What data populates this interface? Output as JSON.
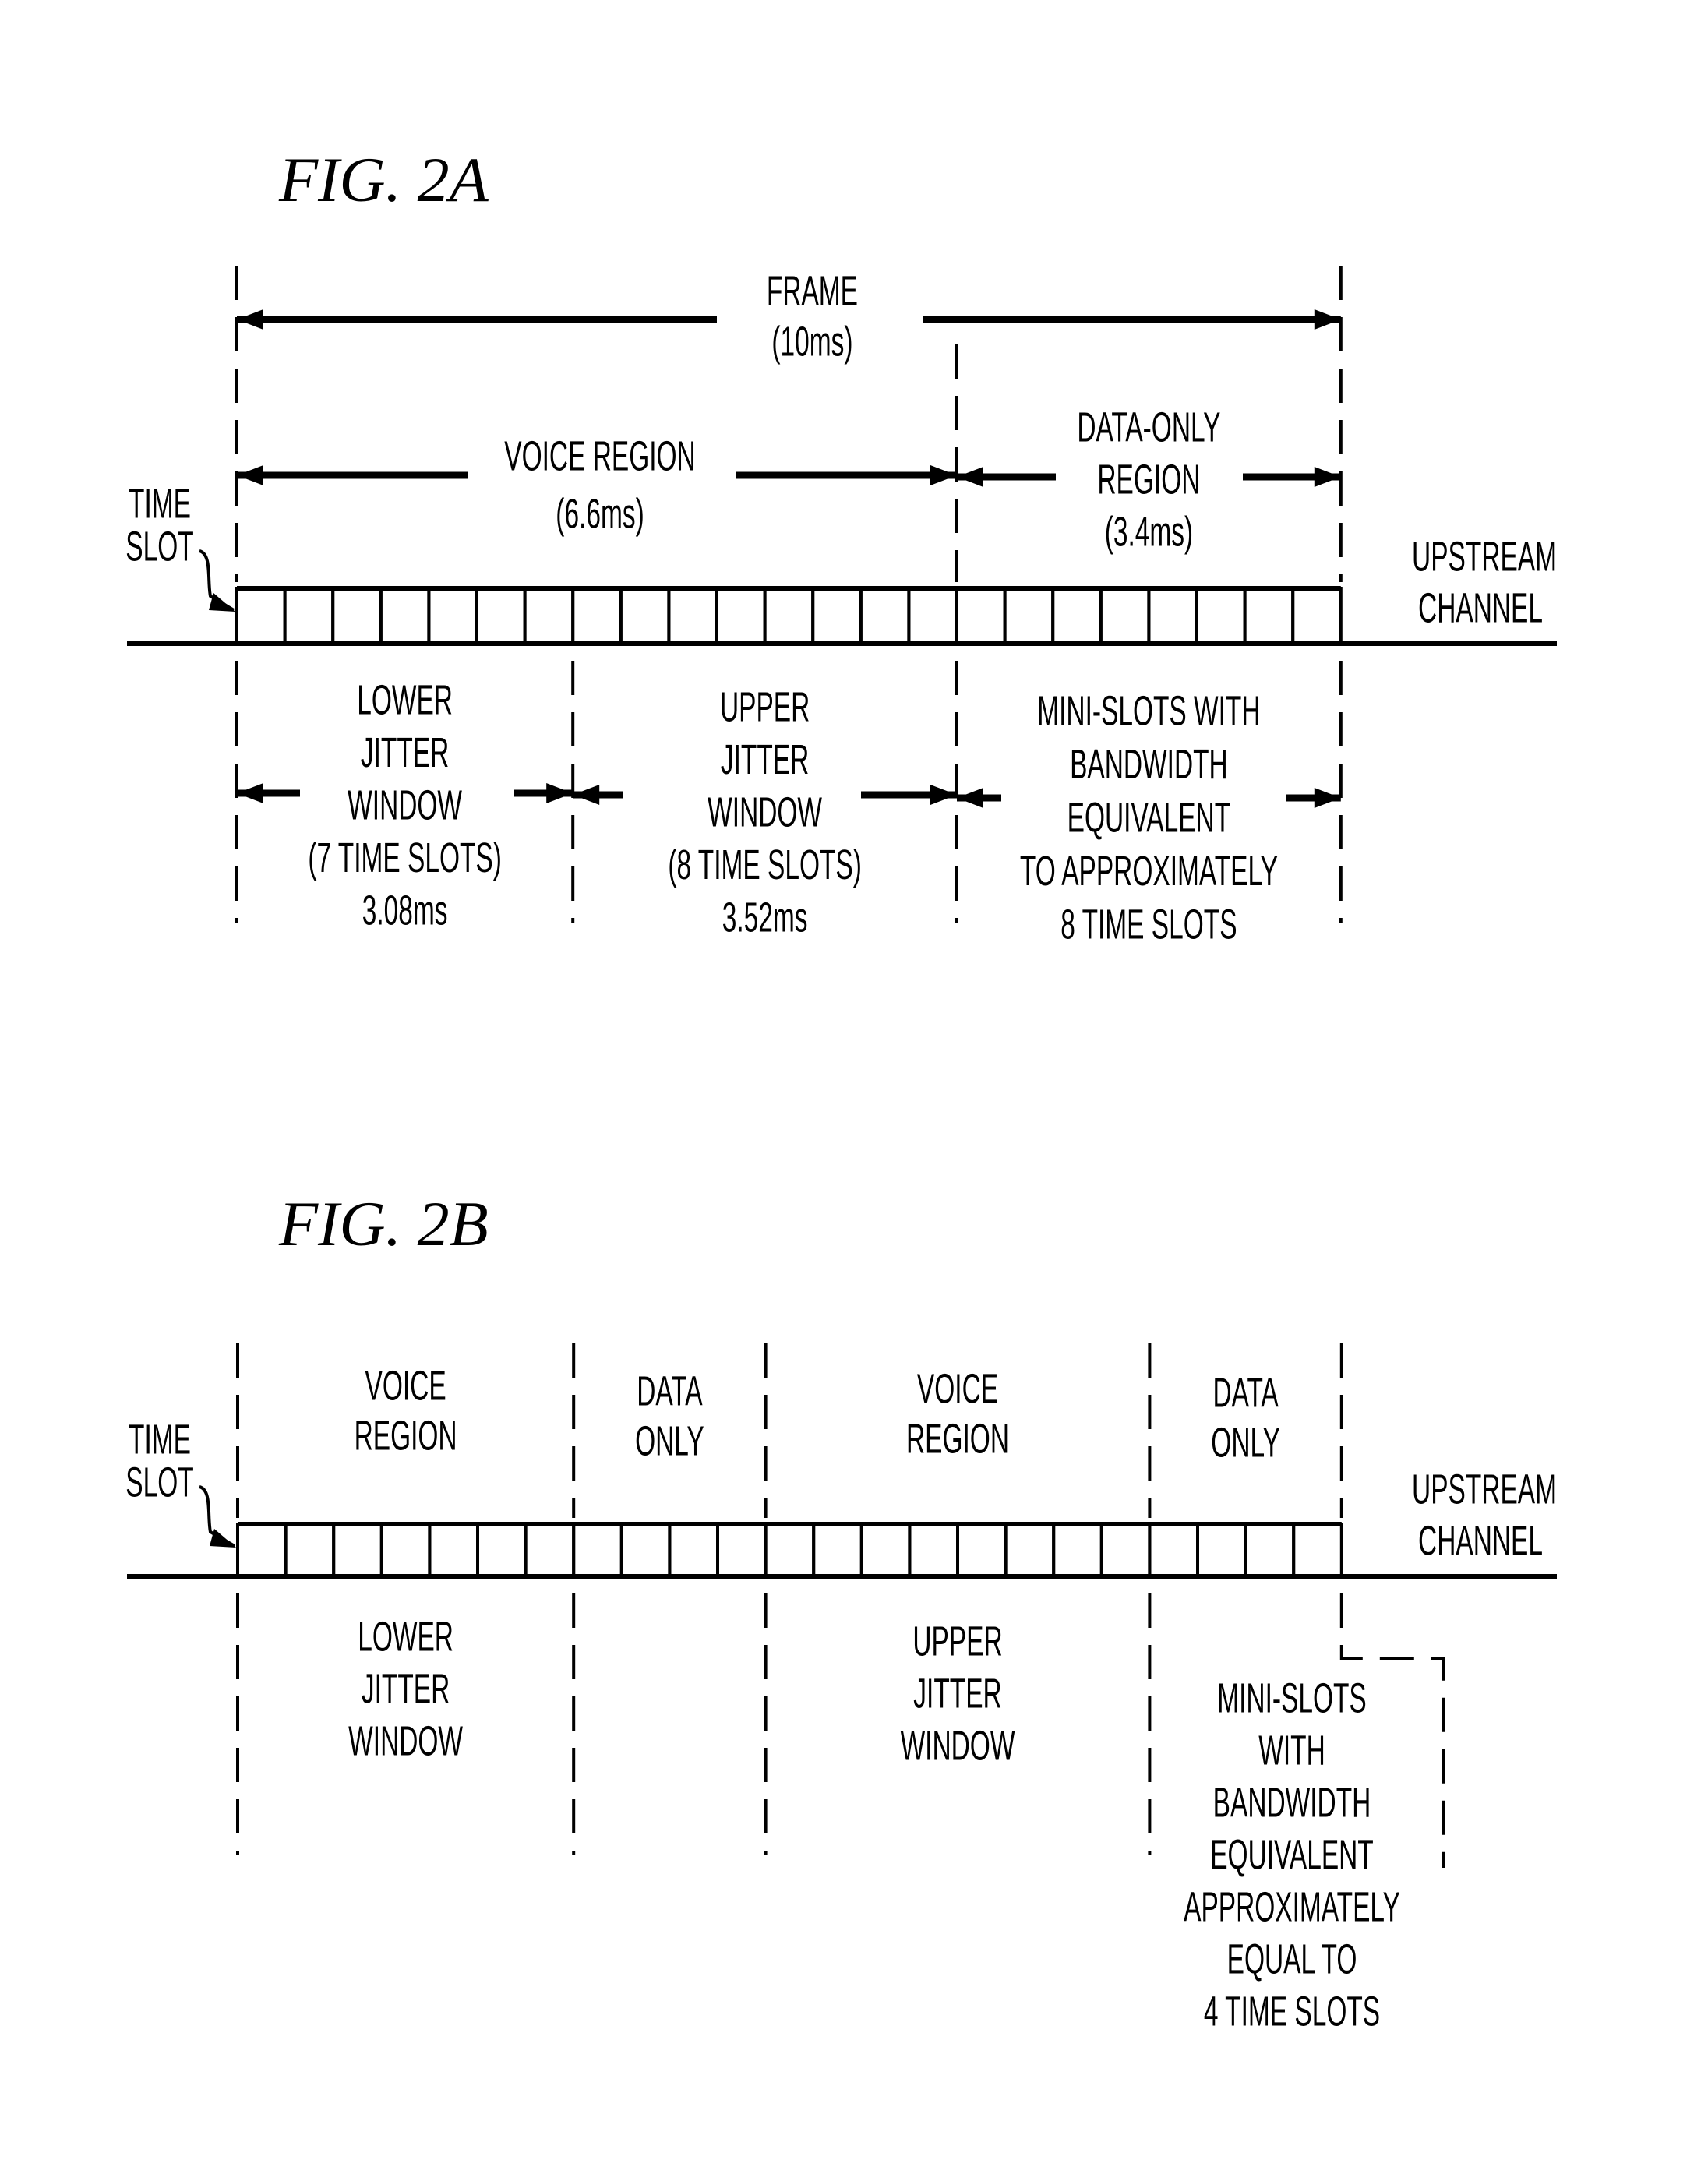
{
  "figures": [
    {
      "id": "fig2a",
      "title": "FIG. 2A",
      "time_slot_label": [
        "TIME",
        "SLOT"
      ],
      "channel_label": [
        "UPSTREAM",
        "CHANNEL"
      ],
      "total_time_slots": 23,
      "frame": {
        "label": "FRAME",
        "duration": "(10ms)"
      },
      "top_regions": [
        {
          "name": "voice-region",
          "lines": [
            "VOICE REGION",
            "(6.6ms)"
          ],
          "slots": 15
        },
        {
          "name": "data-only-region",
          "lines": [
            "DATA-ONLY",
            "REGION",
            "(3.4ms)"
          ],
          "slots": 8
        }
      ],
      "bottom_regions": [
        {
          "name": "lower-jitter-window",
          "lines": [
            "LOWER",
            "JITTER",
            "WINDOW",
            "(7 TIME SLOTS)",
            "3.08ms"
          ],
          "slots": 7
        },
        {
          "name": "upper-jitter-window",
          "lines": [
            "UPPER",
            "JITTER",
            "WINDOW",
            "(8 TIME SLOTS)",
            "3.52ms"
          ],
          "slots": 8
        },
        {
          "name": "mini-slots",
          "lines": [
            "MINI-SLOTS WITH",
            "BANDWIDTH",
            "EQUIVALENT",
            "TO APPROXIMATELY",
            "8 TIME SLOTS"
          ],
          "slots": 8
        }
      ]
    },
    {
      "id": "fig2b",
      "title": "FIG. 2B",
      "time_slot_label": [
        "TIME",
        "SLOT"
      ],
      "channel_label": [
        "UPSTREAM",
        "CHANNEL"
      ],
      "total_time_slots": 23,
      "top_regions": [
        {
          "name": "voice-region-1",
          "lines": [
            "VOICE",
            "REGION"
          ],
          "slots": 7
        },
        {
          "name": "data-only-1",
          "lines": [
            "DATA",
            "ONLY"
          ],
          "slots": 4
        },
        {
          "name": "voice-region-2",
          "lines": [
            "VOICE",
            "REGION"
          ],
          "slots": 8
        },
        {
          "name": "data-only-2",
          "lines": [
            "DATA",
            "ONLY"
          ],
          "slots": 4
        }
      ],
      "bottom_regions": [
        {
          "name": "lower-jitter-window",
          "lines": [
            "LOWER",
            "JITTER",
            "WINDOW"
          ],
          "slots": 7
        },
        {
          "name": "blank",
          "lines": [],
          "slots": 4
        },
        {
          "name": "upper-jitter-window",
          "lines": [
            "UPPER",
            "JITTER",
            "WINDOW"
          ],
          "slots": 8
        },
        {
          "name": "mini-slots",
          "lines": [
            "MINI-SLOTS",
            "WITH",
            "BANDWIDTH",
            "EQUIVALENT",
            "APPROXIMATELY",
            "EQUAL TO",
            "4 TIME SLOTS"
          ],
          "slots": 4
        }
      ]
    }
  ]
}
